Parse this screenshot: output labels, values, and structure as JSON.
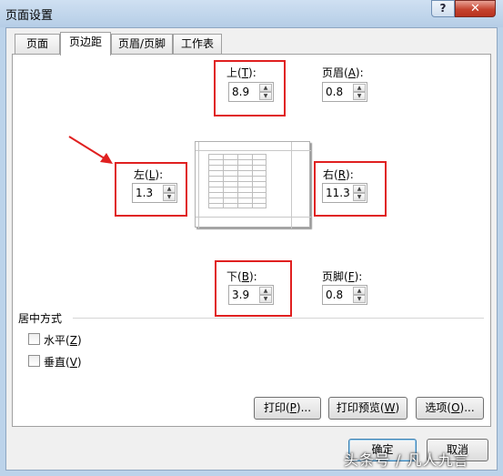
{
  "window": {
    "title": "页面设置",
    "help_label": "?",
    "close_label": "✕"
  },
  "tabs": [
    {
      "label": "页面"
    },
    {
      "label": "页边距"
    },
    {
      "label": "页眉/页脚"
    },
    {
      "label": "工作表"
    }
  ],
  "margins": {
    "top": {
      "label": "上",
      "key": "T",
      "value": "8.9"
    },
    "header": {
      "label": "页眉",
      "key": "A",
      "value": "0.8"
    },
    "left": {
      "label": "左",
      "key": "L",
      "value": "1.3"
    },
    "right": {
      "label": "右",
      "key": "R",
      "value": "11.3"
    },
    "bottom": {
      "label": "下",
      "key": "B",
      "value": "3.9"
    },
    "footer": {
      "label": "页脚",
      "key": "F",
      "value": "0.8"
    }
  },
  "centering": {
    "title": "居中方式",
    "horizontal": {
      "label": "水平",
      "key": "Z",
      "checked": false
    },
    "vertical": {
      "label": "垂直",
      "key": "V",
      "checked": false
    }
  },
  "buttons": {
    "print": {
      "label": "打印",
      "key": "P",
      "suffix": ")..."
    },
    "preview": {
      "label": "打印预览",
      "key": "W",
      "suffix": ")"
    },
    "options": {
      "label": "选项",
      "key": "O",
      "suffix": ")..."
    },
    "ok": "确定",
    "cancel": "取消"
  },
  "watermark": "头条号 / 凡人九言",
  "colors": {
    "highlight": "#e02020",
    "arrow": "#e02020"
  }
}
